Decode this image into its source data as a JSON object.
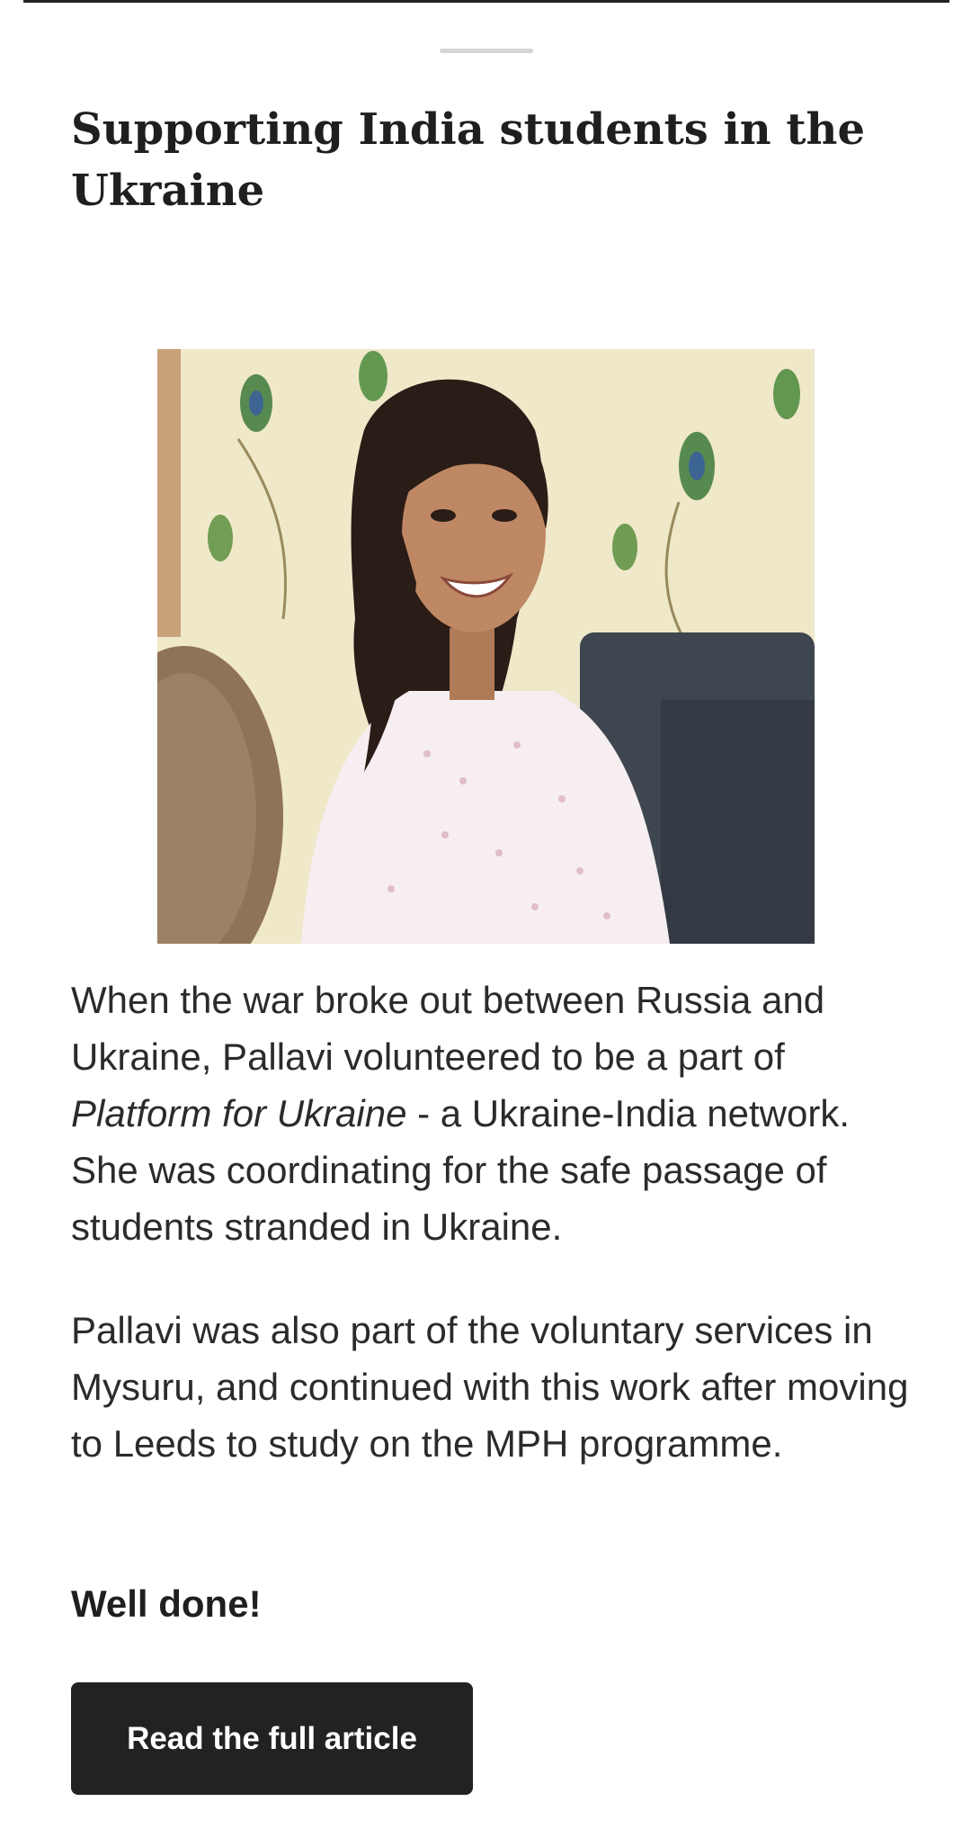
{
  "article": {
    "title": "Supporting India students in the Ukraine",
    "paragraph1": {
      "before_italic": "When the war broke out between Russia and Ukraine, Pallavi volunteered to be a part of ",
      "italic": "Platform for Ukraine",
      "after_italic": " -  a Ukraine-India network. She was coordinating for the safe passage of students stranded in Ukraine."
    },
    "paragraph2": "Pallavi was also part of the voluntary services in Mysuru, and continued with this work after moving to Leeds to study on the MPH programme.",
    "closing": "Well done!",
    "cta_label": "Read the full article"
  },
  "colors": {
    "cta_background": "#222222",
    "text": "#2b2b2b"
  }
}
